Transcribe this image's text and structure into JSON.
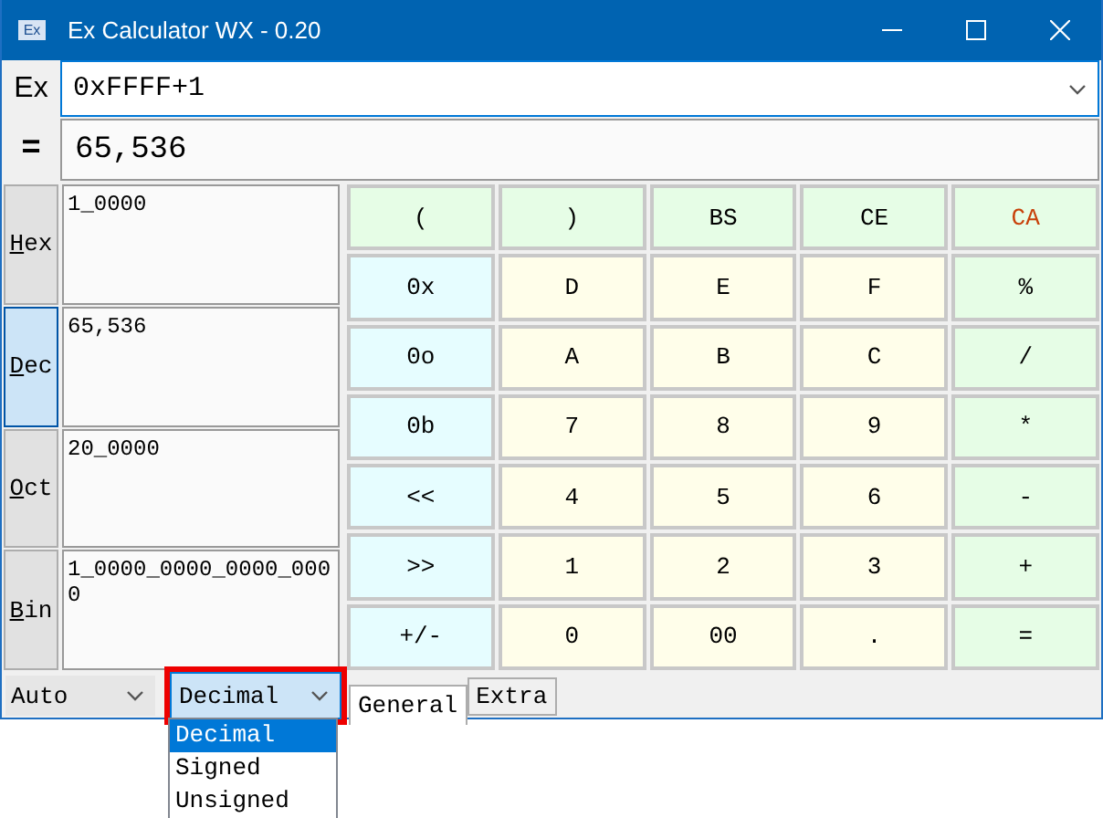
{
  "window": {
    "title": "Ex Calculator WX - 0.20",
    "icon_text": "Ex"
  },
  "expression": {
    "label": "Ex",
    "value": "0xFFFF+1"
  },
  "result": {
    "label": "=",
    "value": "65,536"
  },
  "radix": [
    {
      "label": "Hex",
      "value": "1_0000",
      "selected": false
    },
    {
      "label": "Dec",
      "value": "65,536",
      "selected": true
    },
    {
      "label": "Oct",
      "value": "20_0000",
      "selected": false
    },
    {
      "label": "Bin",
      "value": "1_0000_0000_0000_0000",
      "selected": false
    }
  ],
  "keys": [
    {
      "label": "(",
      "kind": "op"
    },
    {
      "label": ")",
      "kind": "op"
    },
    {
      "label": "BS",
      "kind": "op"
    },
    {
      "label": "CE",
      "kind": "op"
    },
    {
      "label": "CA",
      "kind": "clear"
    },
    {
      "label": "0x",
      "kind": "prefix"
    },
    {
      "label": "D",
      "kind": "digit"
    },
    {
      "label": "E",
      "kind": "digit"
    },
    {
      "label": "F",
      "kind": "digit"
    },
    {
      "label": "%",
      "kind": "op"
    },
    {
      "label": "0o",
      "kind": "prefix"
    },
    {
      "label": "A",
      "kind": "digit"
    },
    {
      "label": "B",
      "kind": "digit"
    },
    {
      "label": "C",
      "kind": "digit"
    },
    {
      "label": "/",
      "kind": "op"
    },
    {
      "label": "0b",
      "kind": "prefix"
    },
    {
      "label": "7",
      "kind": "digit"
    },
    {
      "label": "8",
      "kind": "digit"
    },
    {
      "label": "9",
      "kind": "digit"
    },
    {
      "label": "*",
      "kind": "op"
    },
    {
      "label": "<<",
      "kind": "prefix"
    },
    {
      "label": "4",
      "kind": "digit"
    },
    {
      "label": "5",
      "kind": "digit"
    },
    {
      "label": "6",
      "kind": "digit"
    },
    {
      "label": "-",
      "kind": "op"
    },
    {
      "label": ">>",
      "kind": "prefix"
    },
    {
      "label": "1",
      "kind": "digit"
    },
    {
      "label": "2",
      "kind": "digit"
    },
    {
      "label": "3",
      "kind": "digit"
    },
    {
      "label": "+",
      "kind": "op"
    },
    {
      "label": "+/-",
      "kind": "prefix"
    },
    {
      "label": "0",
      "kind": "digit"
    },
    {
      "label": "00",
      "kind": "digit"
    },
    {
      "label": ".",
      "kind": "digit"
    },
    {
      "label": "=",
      "kind": "op"
    }
  ],
  "bottom": {
    "mode_select": {
      "value": "Auto"
    },
    "type_select": {
      "value": "Decimal",
      "highlighted": true,
      "options": [
        {
          "label": "Decimal",
          "selected": true
        },
        {
          "label": "Signed",
          "selected": false
        },
        {
          "label": "Unsigned",
          "selected": false
        }
      ]
    },
    "tabs": [
      {
        "label": "General",
        "selected": true
      },
      {
        "label": "Extra",
        "selected": false
      }
    ]
  }
}
